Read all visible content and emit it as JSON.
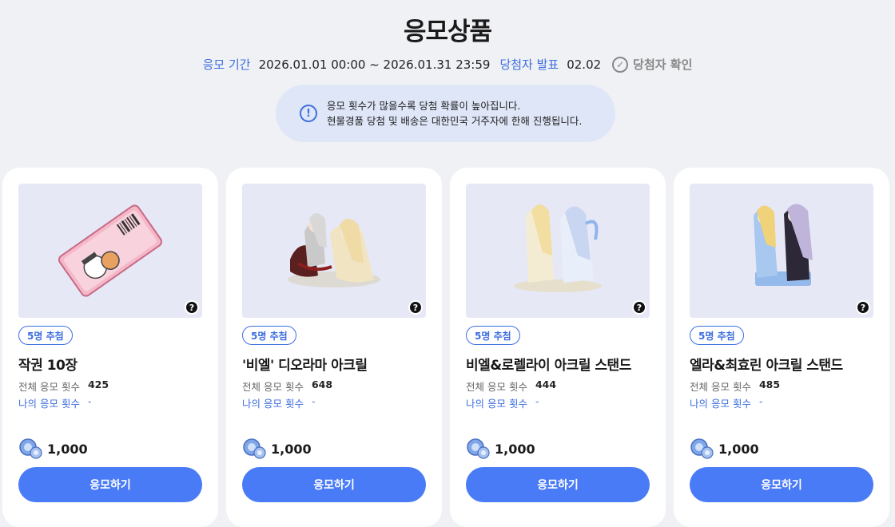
{
  "page": {
    "title": "응모상품"
  },
  "info": {
    "period_label": "응모 기간",
    "period_value": "2026.01.01 00:00 ~ 2026.01.31 23:59",
    "announce_label": "당첨자 발표",
    "announce_value": "02.02",
    "winner_check": "당첨자 확인"
  },
  "notice": {
    "line1": "응모 횟수가 많을수록 당첨 확률이 높아집니다.",
    "line2": "현물경품 당첨 및 배송은 대한민국 거주자에 한해 진행됩니다."
  },
  "cards": [
    {
      "badge": "5명 추첨",
      "name": "작권 10장",
      "total_label": "전체 응모 횟수",
      "total_value": "425",
      "my_label": "나의 응모 횟수",
      "my_value": "-",
      "price": "1,000",
      "button": "응모하기",
      "image_icon": "ticket-image"
    },
    {
      "badge": "5명 추첨",
      "name": "'비엘' 디오라마 아크릴",
      "total_label": "전체 응모 횟수",
      "total_value": "648",
      "my_label": "나의 응모 횟수",
      "my_value": "-",
      "price": "1,000",
      "button": "응모하기",
      "image_icon": "acrylic-diorama-image"
    },
    {
      "badge": "5명 추첨",
      "name": "비엘&로렐라이 아크릴 스탠드",
      "total_label": "전체 응모 횟수",
      "total_value": "444",
      "my_label": "나의 응모 횟수",
      "my_value": "-",
      "price": "1,000",
      "button": "응모하기",
      "image_icon": "acrylic-stand-image"
    },
    {
      "badge": "5명 추첨",
      "name": "엘라&최효린 아크릴 스탠드",
      "total_label": "전체 응모 횟수",
      "total_value": "485",
      "my_label": "나의 응모 횟수",
      "my_value": "-",
      "price": "1,000",
      "button": "응모하기",
      "image_icon": "acrylic-stand-image"
    }
  ],
  "colors": {
    "accent": "#4a7bf7",
    "label_blue": "#3d6ee0",
    "background": "#f0f1f5",
    "image_bg": "#e6e8f6"
  }
}
